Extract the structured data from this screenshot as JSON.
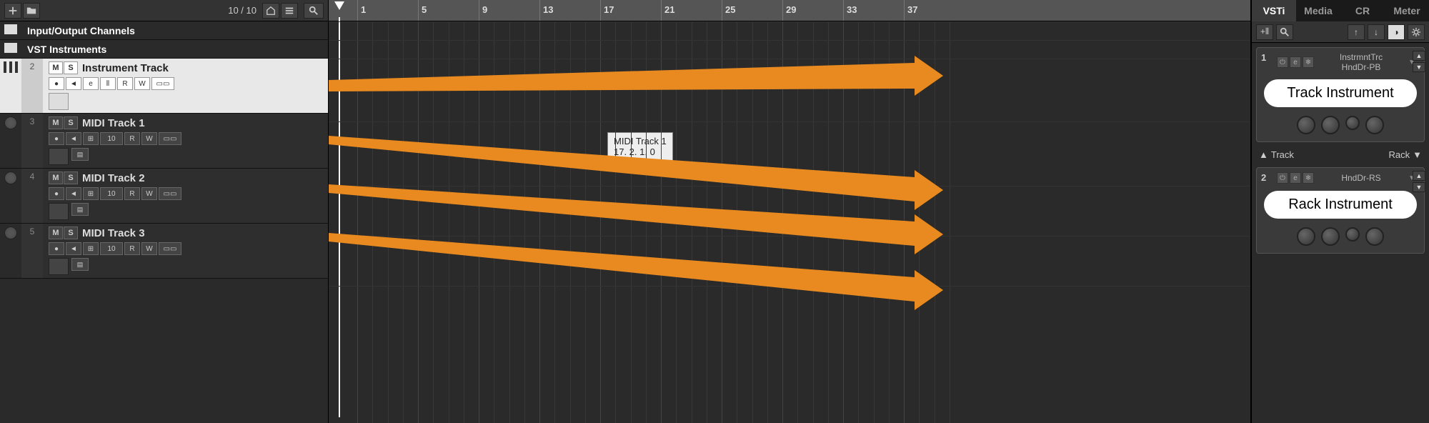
{
  "toolbar": {
    "track_count": "10 / 10"
  },
  "folders": {
    "io": "Input/Output Channels",
    "vst": "VST Instruments"
  },
  "tracks": [
    {
      "num": "2",
      "name": "Instrument Track",
      "type": "instrument"
    },
    {
      "num": "3",
      "name": "MIDI Track 1",
      "type": "midi",
      "ch": "10"
    },
    {
      "num": "4",
      "name": "MIDI Track 2",
      "type": "midi",
      "ch": "10"
    },
    {
      "num": "5",
      "name": "MIDI Track 3",
      "type": "midi",
      "ch": "10"
    }
  ],
  "ruler_marks": [
    "1",
    "5",
    "9",
    "13",
    "17",
    "21",
    "25",
    "29",
    "33",
    "37"
  ],
  "tooltip": {
    "line1": "MIDI Track 1",
    "line2": "17. 2. 1.  0"
  },
  "right_tabs": [
    "VSTi",
    "Media",
    "CR",
    "Meter"
  ],
  "vsti": {
    "slot1": {
      "num": "1",
      "line1": "InstrmntTrc",
      "line2": "HndDr-PB"
    },
    "slot2": {
      "num": "2",
      "name": "HndDr-RS"
    }
  },
  "callouts": {
    "track_instrument": "Track Instrument",
    "rack_instrument": "Rack Instrument"
  },
  "divider": {
    "left": "Track",
    "right": "Rack"
  },
  "buttons": {
    "m": "M",
    "s": "S",
    "r": "R",
    "w": "W",
    "e": "e"
  }
}
